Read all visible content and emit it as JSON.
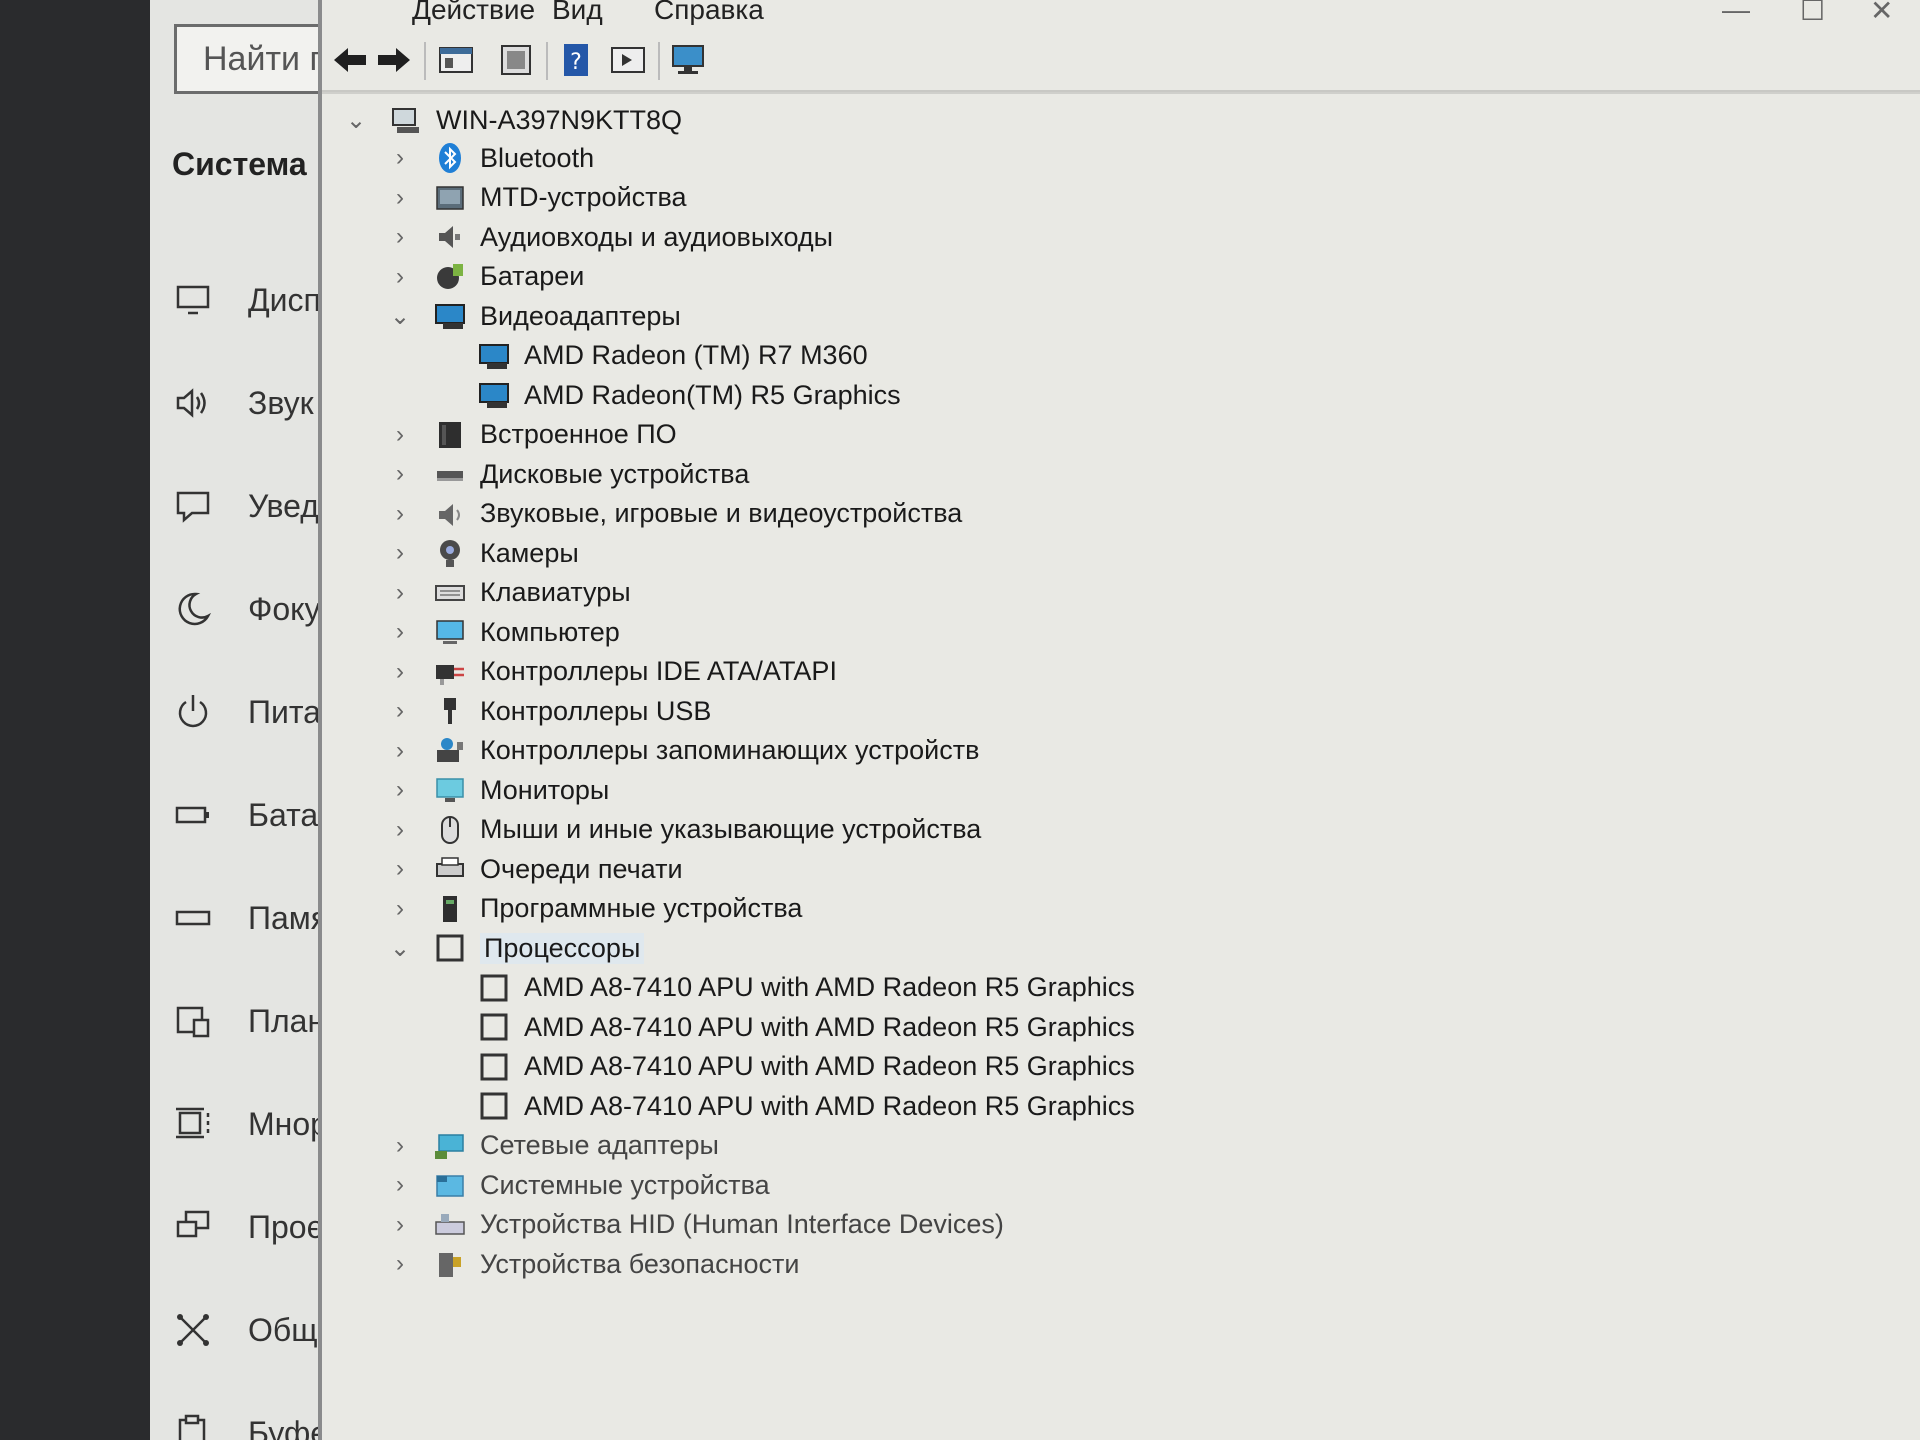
{
  "settings": {
    "search_placeholder": "Найти п",
    "section_title": "Система",
    "nav": [
      {
        "label": "Дисп",
        "icon": "display-icon"
      },
      {
        "label": "Звук",
        "icon": "speaker-icon"
      },
      {
        "label": "Увед",
        "icon": "notification-icon"
      },
      {
        "label": "Фоку",
        "icon": "moon-icon"
      },
      {
        "label": "Пита",
        "icon": "power-icon"
      },
      {
        "label": "Батар",
        "icon": "battery-icon"
      },
      {
        "label": "Памя",
        "icon": "storage-icon"
      },
      {
        "label": "План",
        "icon": "tablet-mode-icon"
      },
      {
        "label": "Мнор",
        "icon": "multitasking-icon"
      },
      {
        "label": "Проє",
        "icon": "projecting-icon"
      },
      {
        "label": "Общ",
        "icon": "shared-experiences-icon"
      },
      {
        "label": "Буфе",
        "icon": "clipboard-icon"
      }
    ]
  },
  "device_manager": {
    "menu": [
      "Действие",
      "Вид",
      "Справка"
    ],
    "window_controls": {
      "minimize": "—",
      "maximize": "☐",
      "close": "✕"
    },
    "toolbar": [
      "back-arrow-icon",
      "forward-arrow-icon",
      "properties-icon",
      "update-driver-icon",
      "help-icon",
      "view-icon",
      "monitor-icon"
    ],
    "root": "WIN-A397N9KTT8Q",
    "tree": [
      {
        "label": "Bluetooth",
        "icon": "bluetooth-icon",
        "level": 1,
        "chevron": "›"
      },
      {
        "label": "MTD-устройства",
        "icon": "mtd-device-icon",
        "level": 1,
        "chevron": "›"
      },
      {
        "label": "Аудиовходы и аудиовыходы",
        "icon": "audio-icon",
        "level": 1,
        "chevron": "›"
      },
      {
        "label": "Батареи",
        "icon": "battery-icon",
        "level": 1,
        "chevron": "›"
      },
      {
        "label": "Видеоадаптеры",
        "icon": "display-adapter-icon",
        "level": 1,
        "chevron": "⌄"
      },
      {
        "label": "AMD Radeon (TM) R7 M360",
        "icon": "display-adapter-icon",
        "level": 2,
        "chevron": ""
      },
      {
        "label": "AMD Radeon(TM) R5 Graphics",
        "icon": "display-adapter-icon",
        "level": 2,
        "chevron": ""
      },
      {
        "label": "Встроенное ПО",
        "icon": "firmware-icon",
        "level": 1,
        "chevron": "›"
      },
      {
        "label": "Дисковые устройства",
        "icon": "disk-icon",
        "level": 1,
        "chevron": "›"
      },
      {
        "label": "Звуковые, игровые и видеоустройства",
        "icon": "sound-icon",
        "level": 1,
        "chevron": "›"
      },
      {
        "label": "Камеры",
        "icon": "camera-icon",
        "level": 1,
        "chevron": "›"
      },
      {
        "label": "Клавиатуры",
        "icon": "keyboard-icon",
        "level": 1,
        "chevron": "›"
      },
      {
        "label": "Компьютер",
        "icon": "computer-icon",
        "level": 1,
        "chevron": "›"
      },
      {
        "label": "Контроллеры IDE ATA/ATAPI",
        "icon": "ide-controller-icon",
        "level": 1,
        "chevron": "›"
      },
      {
        "label": "Контроллеры USB",
        "icon": "usb-icon",
        "level": 1,
        "chevron": "›"
      },
      {
        "label": "Контроллеры запоминающих устройств",
        "icon": "storage-controller-icon",
        "level": 1,
        "chevron": "›"
      },
      {
        "label": "Мониторы",
        "icon": "monitor-icon",
        "level": 1,
        "chevron": "›"
      },
      {
        "label": "Мыши и иные указывающие устройства",
        "icon": "mouse-icon",
        "level": 1,
        "chevron": "›"
      },
      {
        "label": "Очереди печати",
        "icon": "printer-icon",
        "level": 1,
        "chevron": "›"
      },
      {
        "label": "Программные устройства",
        "icon": "software-device-icon",
        "level": 1,
        "chevron": "›"
      },
      {
        "label": "Процессоры",
        "icon": "processor-icon",
        "level": 1,
        "chevron": "⌄",
        "selected": true
      },
      {
        "label": "AMD A8-7410 APU with AMD Radeon R5 Graphics",
        "icon": "processor-icon",
        "level": 2,
        "chevron": ""
      },
      {
        "label": "AMD A8-7410 APU with AMD Radeon R5 Graphics",
        "icon": "processor-icon",
        "level": 2,
        "chevron": ""
      },
      {
        "label": "AMD A8-7410 APU with AMD Radeon R5 Graphics",
        "icon": "processor-icon",
        "level": 2,
        "chevron": ""
      },
      {
        "label": "AMD A8-7410 APU with AMD Radeon R5 Graphics",
        "icon": "processor-icon",
        "level": 2,
        "chevron": ""
      },
      {
        "label": "Сетевые адаптеры",
        "icon": "network-adapter-icon",
        "level": 1,
        "chevron": "›"
      },
      {
        "label": "Системные устройства",
        "icon": "system-device-icon",
        "level": 1,
        "chevron": "›"
      },
      {
        "label": "Устройства HID (Human Interface Devices)",
        "icon": "hid-icon",
        "level": 1,
        "chevron": "›"
      },
      {
        "label": "Устройства безопасности",
        "icon": "security-device-icon",
        "level": 1,
        "chevron": "›"
      }
    ]
  }
}
